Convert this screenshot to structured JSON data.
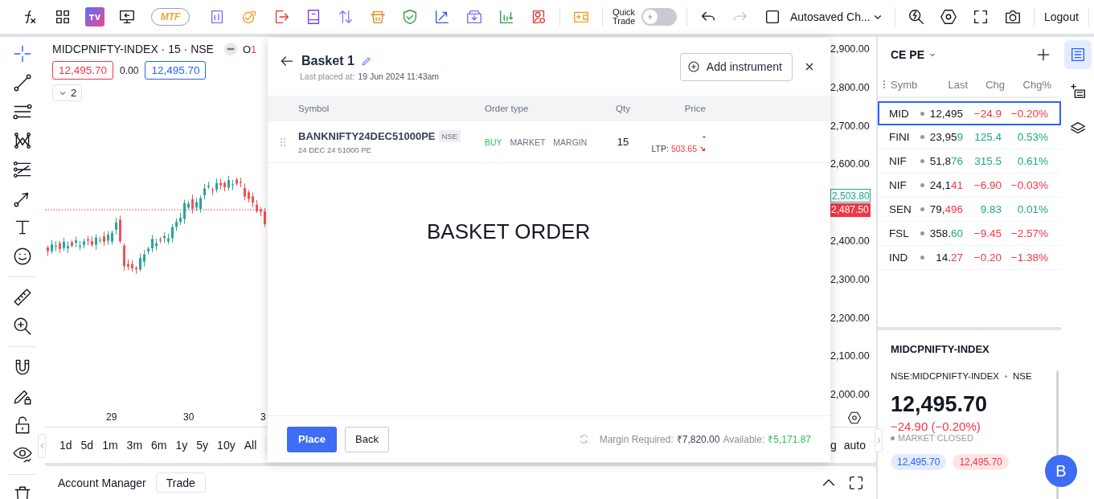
{
  "toolbar": {
    "mtf": "MTF",
    "quick_trade_label": "Quick Trade",
    "quick_trade_on": false,
    "redo_disabled": true,
    "chart_name": "Autosaved Ch...",
    "logout": "Logout"
  },
  "tools": [
    {
      "kind": "crosshair",
      "selected": true
    },
    {
      "kind": "trend-line",
      "selected": false
    },
    {
      "kind": "horizontal-lines",
      "selected": false
    },
    {
      "kind": "pattern",
      "selected": false
    },
    {
      "kind": "levels",
      "selected": false
    },
    {
      "kind": "arrow",
      "selected": false
    },
    {
      "kind": "text",
      "selected": false
    },
    {
      "kind": "smiley",
      "selected": false
    },
    {
      "kind": "ruler",
      "selected": false
    },
    {
      "kind": "zoom-in",
      "selected": false
    },
    {
      "kind": "magnet",
      "selected": false
    },
    {
      "kind": "pencil-lock",
      "selected": false
    },
    {
      "kind": "lock",
      "selected": false
    },
    {
      "kind": "eye",
      "selected": false
    },
    {
      "kind": "trash",
      "selected": false
    }
  ],
  "chart": {
    "symbol": "MIDCPNIFTY-INDEX · 15 · NSE",
    "ohlc_label": "O",
    "ohlc_value": "1",
    "bid": "12,495.70",
    "spread": "0.00",
    "ask": "12,495.70",
    "indicators_count": "2",
    "time_labels": [
      "29",
      "30",
      "3"
    ],
    "price_labels": [
      "2,900.00",
      "2,800.00",
      "2,700.00",
      "2,600.00",
      "2,400.00",
      "2,300.00",
      "2,200.00",
      "2,100.00",
      "2,000.00"
    ],
    "price_tags": [
      {
        "text": "2,503.80",
        "kind": "outline"
      },
      {
        "text": "2,487.50",
        "kind": "filled"
      }
    ],
    "ranges": [
      "1d",
      "5d",
      "1m",
      "3m",
      "6m",
      "1y",
      "5y",
      "10y",
      "All"
    ],
    "cut_label": "g",
    "scale_mode": "auto"
  },
  "basket": {
    "title": "Basket 1",
    "last_placed_label": "Last placed at:",
    "last_placed": "19 Jun 2024 11:43am",
    "add_button": "Add instrument",
    "columns": [
      "Symbol",
      "Order type",
      "Qty",
      "Price"
    ],
    "orders": [
      {
        "symbol": "BANKNIFTY24DEC51000PE",
        "exchange": "NSE",
        "contract": "24 DEC 24 51000 PE",
        "side": "BUY",
        "buy": true,
        "order_type": "MARKET",
        "product": "MARGIN",
        "qty": "15",
        "price": "-",
        "ltp_label": "LTP:",
        "ltp": "503.65",
        "falling": true
      }
    ],
    "body_text": "BASKET ORDER",
    "place_button": "Place",
    "back_button": "Back",
    "margin_label": "Margin Required:",
    "margin_value": "₹7,820.00",
    "available_label": "Available:",
    "available_value": "₹5,171.87"
  },
  "bottom_panel": {
    "title": "Account Manager",
    "trade_button": "Trade"
  },
  "watchlist": {
    "title": "CE PE",
    "columns": [
      "Symb",
      "Last",
      "Chg",
      "Chg%"
    ],
    "rows": [
      {
        "symbol": "MID",
        "last": "12,495",
        "change": "−24.9",
        "change_pct": "−0.20%",
        "falling": true,
        "selected": true
      },
      {
        "symbol": "FINI",
        "last": "23,95",
        "last_tail": "9",
        "tail_falling": false,
        "change": "125.4",
        "change_pct": "0.53%",
        "falling": false,
        "selected": false
      },
      {
        "symbol": "NIF",
        "last": "51,8",
        "last_tail": "76",
        "tail_falling": false,
        "change": "315.5",
        "change_pct": "0.61%",
        "falling": false,
        "selected": false
      },
      {
        "symbol": "NIF",
        "last": "24,1",
        "last_tail": "41",
        "tail_falling": true,
        "change": "−6.90",
        "change_pct": "−0.03%",
        "falling": true,
        "selected": false
      },
      {
        "symbol": "SEN",
        "last": "79,",
        "last_tail": "496",
        "tail_falling": true,
        "change": "9.83",
        "change_pct": "0.01%",
        "falling": false,
        "selected": false
      },
      {
        "symbol": "FSL",
        "last": "358.",
        "last_tail": "60",
        "tail_falling": false,
        "change": "−9.45",
        "change_pct": "−2.57%",
        "falling": true,
        "selected": false
      },
      {
        "symbol": "IND",
        "last": "14.",
        "last_tail": "27",
        "tail_falling": true,
        "change": "−0.20",
        "change_pct": "−1.38%",
        "falling": true,
        "selected": false
      }
    ]
  },
  "detail": {
    "title": "MIDCPNIFTY-INDEX",
    "full_symbol": "NSE:MIDCPNIFTY-INDEX",
    "exchange": "NSE",
    "price": "12,495.70",
    "change": "−24.90 (−0.20%)",
    "falling": true,
    "status": "MARKET CLOSED",
    "bid": "12,495.70",
    "ask": "12,495.70"
  },
  "avatar": "B",
  "rail": [
    {
      "kind": "watchlist",
      "selected": true
    },
    {
      "kind": "add-list",
      "selected": false
    },
    {
      "kind": "layers",
      "selected": false
    }
  ]
}
